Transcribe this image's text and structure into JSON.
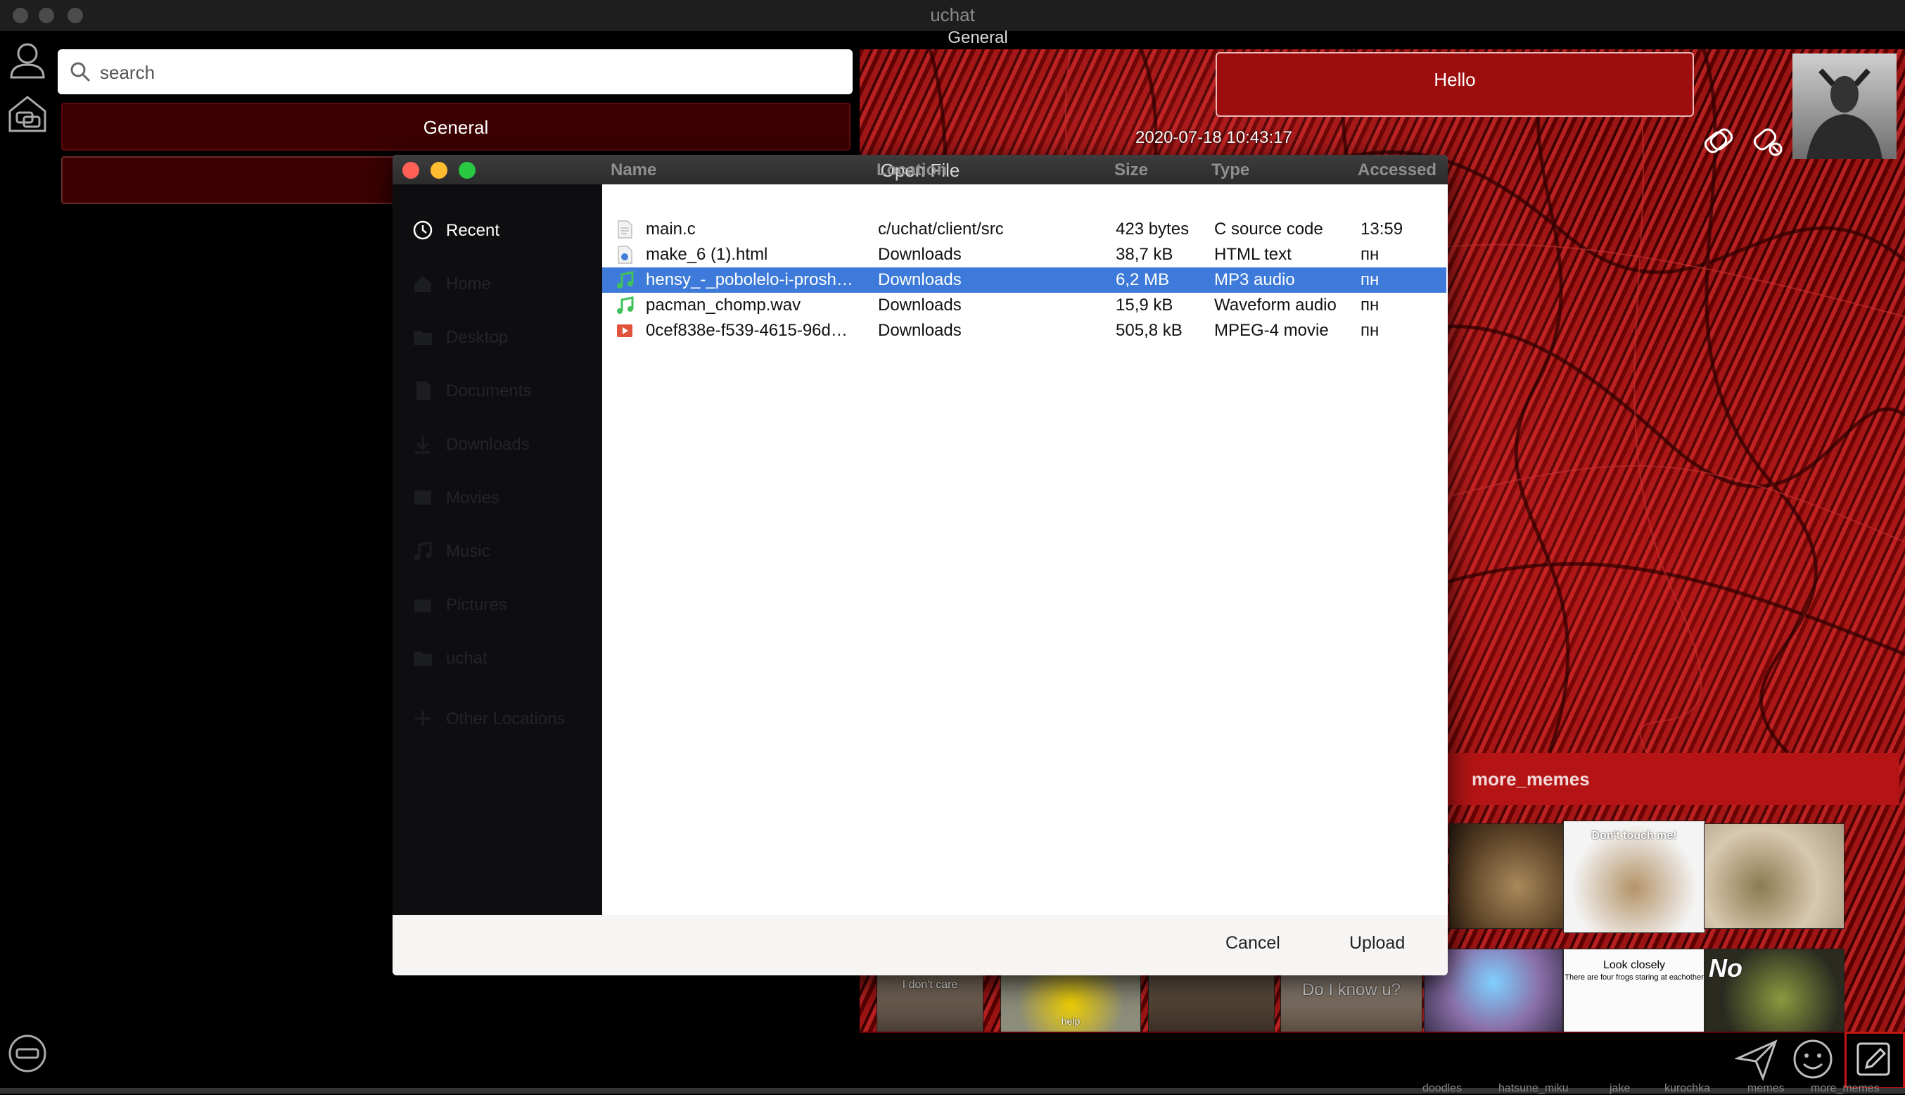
{
  "window": {
    "title": "uchat",
    "chat_title": "General"
  },
  "search": {
    "placeholder": "search"
  },
  "rooms": [
    {
      "label": "General"
    },
    {
      "label": ""
    }
  ],
  "chat": {
    "message": "Hello",
    "timestamp": "2020-07-18 10:43:17"
  },
  "memes": {
    "title": "more_memes",
    "sticker_texts": [
      "Don't touch me!",
      "Look closely",
      "There are four frogs staring at eachother",
      "No",
      "I don't care",
      "help",
      "Do I know u?"
    ]
  },
  "bottom_tags": [
    "doodles",
    "hatsune_miku",
    "jake",
    "kurochka",
    "memes",
    "more_memes"
  ],
  "dialog": {
    "title": "Open File",
    "sidebar": [
      {
        "label": "Recent",
        "icon": "clock-icon"
      },
      {
        "label": "Home",
        "icon": "home-icon"
      },
      {
        "label": "Desktop",
        "icon": "folder-icon"
      },
      {
        "label": "Documents",
        "icon": "document-icon"
      },
      {
        "label": "Downloads",
        "icon": "download-icon"
      },
      {
        "label": "Movies",
        "icon": "film-icon"
      },
      {
        "label": "Music",
        "icon": "music-icon"
      },
      {
        "label": "Pictures",
        "icon": "camera-icon"
      },
      {
        "label": "uchat",
        "icon": "folder-icon"
      },
      {
        "label": "Other Locations",
        "icon": "plus-icon"
      }
    ],
    "columns": [
      "Name",
      "Location",
      "Size",
      "Type",
      "Accessed"
    ],
    "files": [
      {
        "name": "main.c",
        "location": "c/uchat/client/src",
        "size": "423 bytes",
        "type": "C source code",
        "accessed": "13:59",
        "icon": "text-file-icon"
      },
      {
        "name": "make_6 (1).html",
        "location": "Downloads",
        "size": "38,7 kB",
        "type": "HTML text",
        "accessed": "пн",
        "icon": "html-file-icon"
      },
      {
        "name": "hensy_-_pobolelo-i-prosh…",
        "location": "Downloads",
        "size": "6,2 MB",
        "type": "MP3 audio",
        "accessed": "пн",
        "icon": "audio-file-icon"
      },
      {
        "name": "pacman_chomp.wav",
        "location": "Downloads",
        "size": "15,9 kB",
        "type": "Waveform audio",
        "accessed": "пн",
        "icon": "audio-file-icon"
      },
      {
        "name": "0cef838e-f539-4615-96d…",
        "location": "Downloads",
        "size": "505,8 kB",
        "type": "MPEG-4 movie",
        "accessed": "пн",
        "icon": "video-file-icon"
      }
    ],
    "selected_index": 2,
    "cancel_label": "Cancel",
    "upload_label": "Upload"
  },
  "colors": {
    "accent_red": "#b51414",
    "selection_blue": "#3d7ad9"
  }
}
